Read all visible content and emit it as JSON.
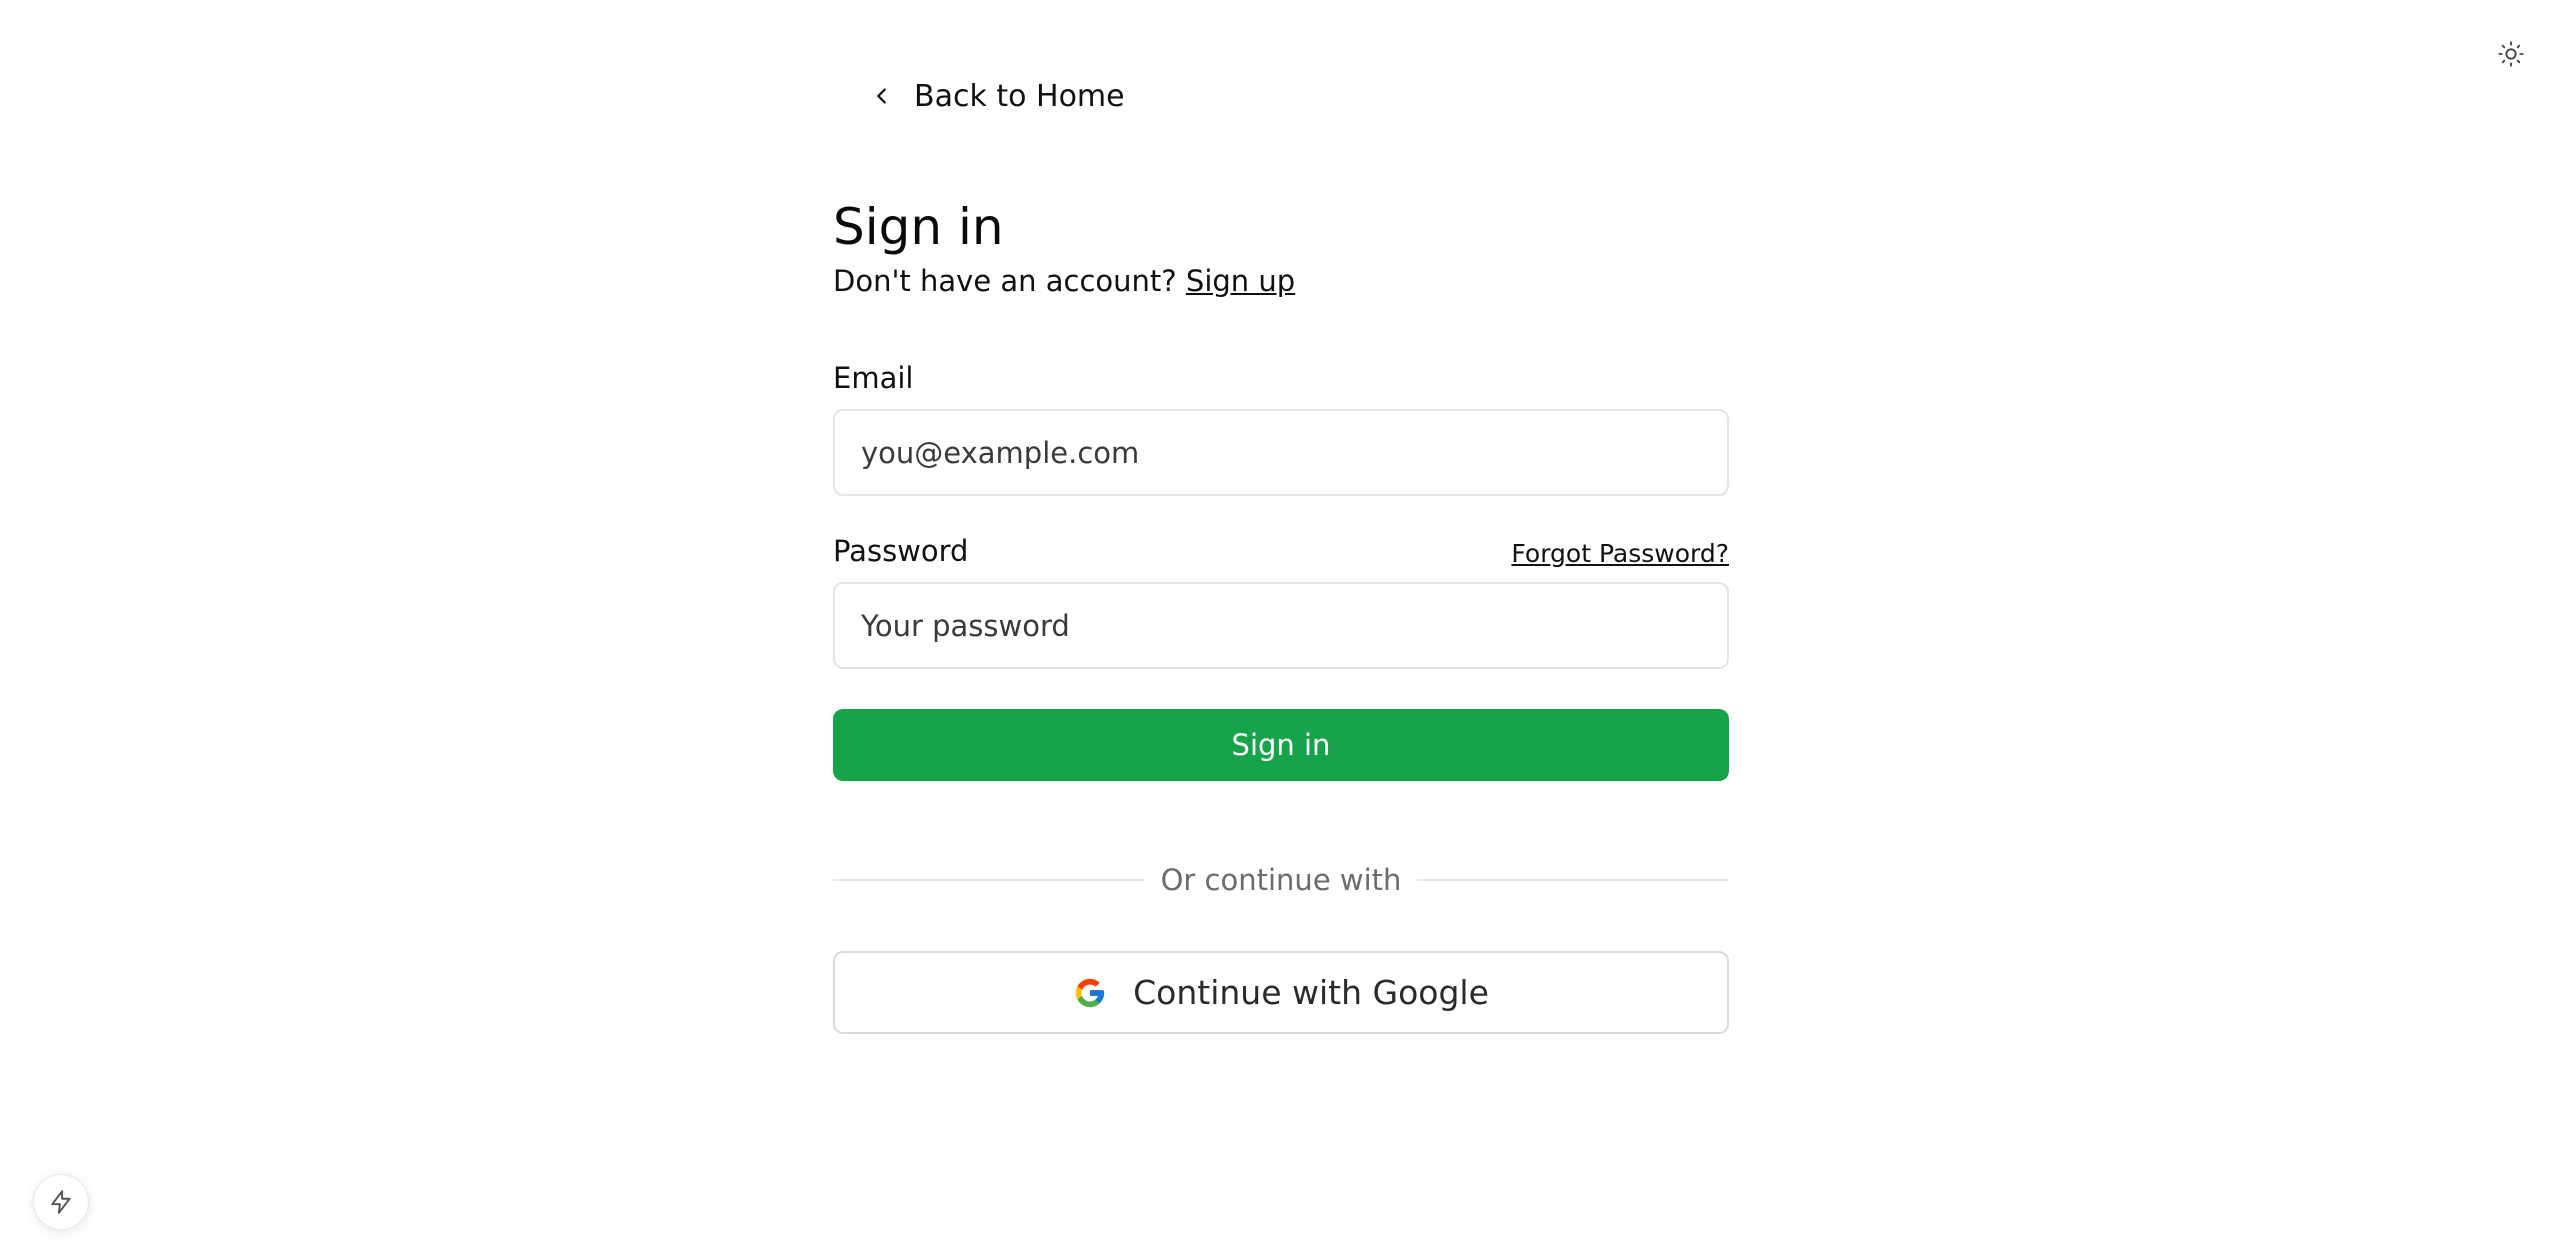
{
  "nav": {
    "back_label": "Back to Home",
    "back_icon": "chevron-left-icon",
    "theme_icon": "sun-icon"
  },
  "auth": {
    "title": "Sign in",
    "subtitle_prefix": "Don't have an account?",
    "signup_link": "Sign up",
    "email_label": "Email",
    "email_placeholder": "you@example.com",
    "email_value": "",
    "password_label": "Password",
    "forgot_link": "Forgot Password?",
    "password_placeholder": "Your password",
    "password_value": "",
    "submit_label": "Sign in",
    "divider_text": "Or continue with",
    "google_label": "Continue with Google",
    "google_icon": "google-logo-icon"
  },
  "devtools": {
    "icon": "lightning-bolt-icon"
  },
  "colors": {
    "primary": "#16a34a",
    "border": "#e2e4e8",
    "muted_text": "#6b6b6b"
  }
}
